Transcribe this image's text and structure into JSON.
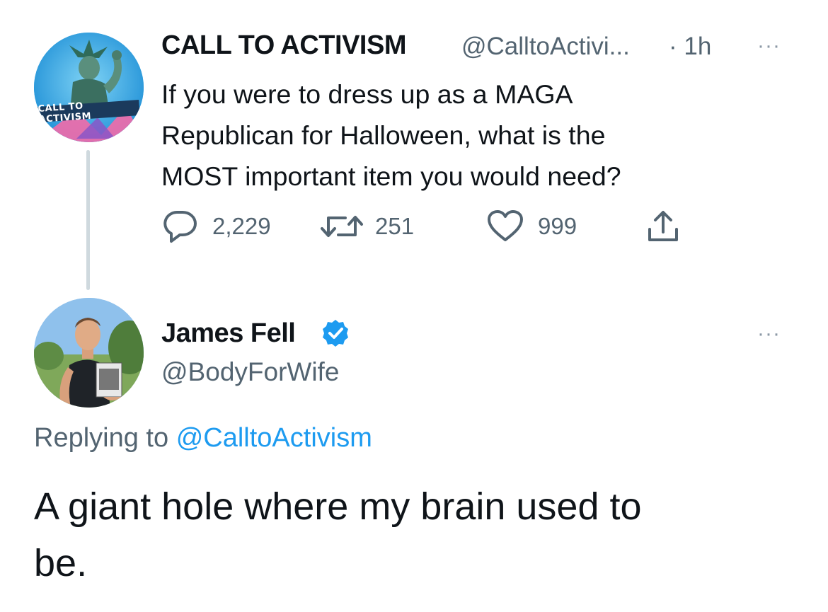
{
  "parent_tweet": {
    "author_name": "CALL TO ACTIVISM",
    "author_handle": "@CalltoActivi...",
    "time": "· 1h",
    "avatar_text": "CALL TO ACTIVISM",
    "text_lines": [
      "If you were to dress up as a MAGA",
      "Republican for Halloween, what is the",
      "MOST important item you would need?"
    ],
    "actions": {
      "replies": "2,229",
      "retweets": "251",
      "likes": "999"
    },
    "more_label": "···"
  },
  "reply_tweet": {
    "author_name": "James Fell",
    "author_handle": "@BodyForWife",
    "verified": true,
    "more_label": "···",
    "replying_prefix": "Replying to",
    "replying_handle": "@CalltoActivism",
    "text_lines": [
      "A giant hole where my brain used to",
      "be."
    ]
  },
  "colors": {
    "text": "#0f1419",
    "secondary": "#536471",
    "link": "#1d9bf0",
    "thread_line": "#cfd9de"
  },
  "icons": [
    "reply-icon",
    "retweet-icon",
    "like-icon",
    "share-icon",
    "verified-badge-icon",
    "more-icon"
  ]
}
